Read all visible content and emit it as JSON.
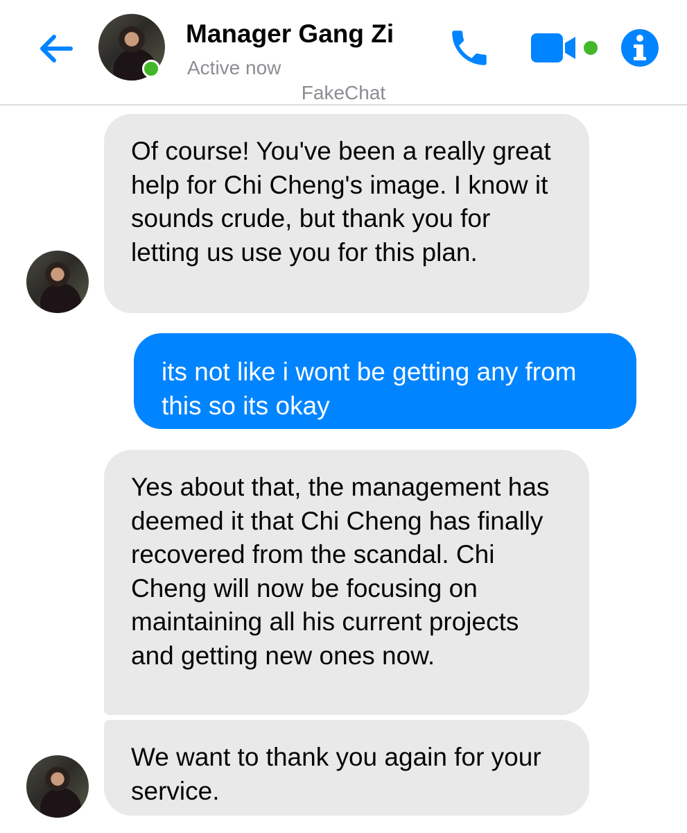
{
  "header": {
    "back_icon": "arrow-left-icon",
    "contact_name": "Manager Gang Zi",
    "status": "Active now",
    "watermark": "FakeChat",
    "call_icon": "phone-icon",
    "video_icon": "video-camera-icon",
    "info_icon": "info-icon"
  },
  "colors": {
    "accent": "#0084ff",
    "online": "#42b72a",
    "incoming_bubble": "#e9e9e9",
    "status_text": "#8a8d91"
  },
  "messages": [
    {
      "from": "contact",
      "text": "Of course! You've been a really great help for Chi Cheng's image. I know it sounds crude, but thank you for letting us use you for this plan."
    },
    {
      "from": "me",
      "text": "its not like i wont be getting any from this so its okay"
    },
    {
      "from": "contact",
      "text": "Yes about that, the management has deemed it that Chi Cheng has finally recovered from the scandal. Chi Cheng will now be focusing on maintaining all his current projects and getting new ones now."
    },
    {
      "from": "contact",
      "text": "We want to thank you again for your service."
    }
  ]
}
